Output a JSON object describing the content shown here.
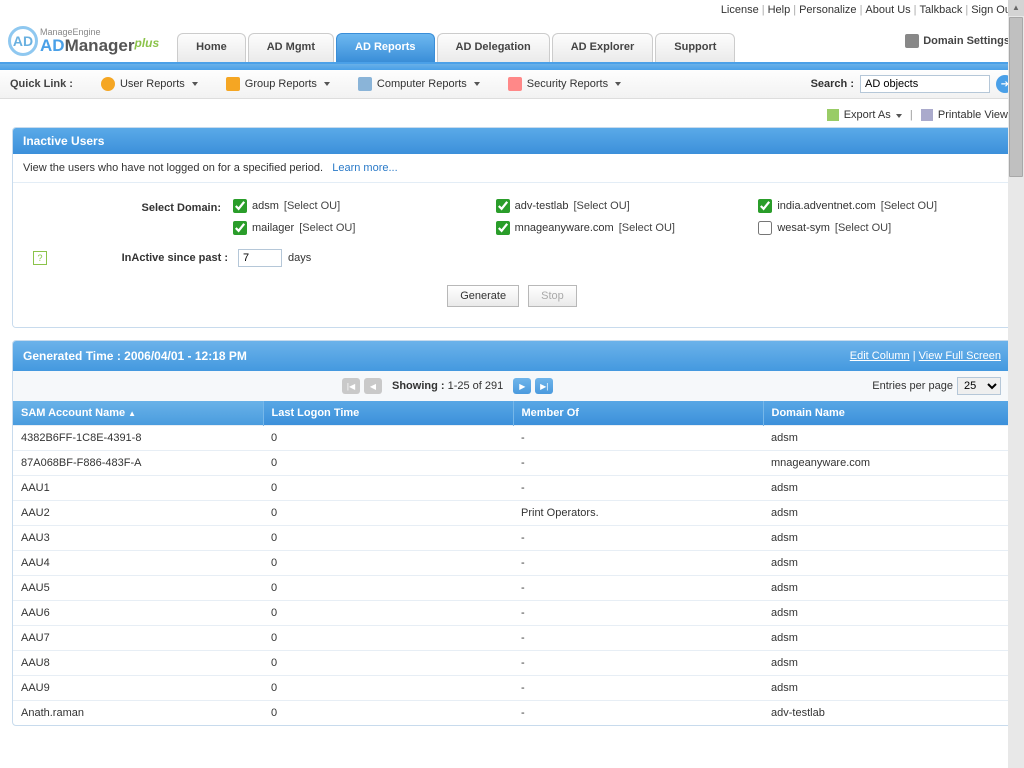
{
  "top_links": [
    "License",
    "Help",
    "Personalize",
    "About Us",
    "Talkback",
    "Sign Out"
  ],
  "logo": {
    "small": "ManageEngine",
    "main_a": "AD",
    "main_m": "Manager",
    "plus": "plus",
    "circle": "AD"
  },
  "tabs": [
    "Home",
    "AD Mgmt",
    "AD Reports",
    "AD Delegation",
    "AD Explorer",
    "Support"
  ],
  "active_tab": 2,
  "domain_settings": "Domain Settings",
  "quick": {
    "label": "Quick Link :",
    "items": [
      "User Reports",
      "Group Reports",
      "Computer Reports",
      "Security Reports"
    ]
  },
  "search": {
    "label": "Search :",
    "value": "AD objects"
  },
  "toolbar": {
    "export": "Export As",
    "printable": "Printable View"
  },
  "panel1": {
    "title": "Inactive Users",
    "desc": "View the users who have not logged on for a specified period.",
    "learn": "Learn more...",
    "select_domain": "Select Domain:",
    "select_ou": "[Select OU]",
    "domains": [
      {
        "name": "adsm",
        "checked": true
      },
      {
        "name": "adv-testlab",
        "checked": true
      },
      {
        "name": "india.adventnet.com",
        "checked": true
      },
      {
        "name": "mailager",
        "checked": true
      },
      {
        "name": "mnageanyware.com",
        "checked": true
      },
      {
        "name": "wesat-sym",
        "checked": false
      }
    ],
    "inactive_label": "InActive since past :",
    "days_value": "7",
    "days_unit": "days",
    "generate": "Generate",
    "stop": "Stop"
  },
  "panel2": {
    "title": "Generated Time : 2006/04/01 - 12:18 PM",
    "edit_col": "Edit Column",
    "full": "View Full Screen",
    "showing_label": "Showing :",
    "showing_range": "1-25 of 291",
    "epp_label": "Entries per page",
    "epp_value": "25",
    "columns": [
      "SAM Account Name",
      "Last Logon Time",
      "Member Of",
      "Domain Name"
    ],
    "sort_col": 0,
    "rows": [
      {
        "sam": "4382B6FF-1C8E-4391-8",
        "last": "0",
        "member": "-",
        "domain": "adsm"
      },
      {
        "sam": "87A068BF-F886-483F-A",
        "last": "0",
        "member": "-",
        "domain": "mnageanyware.com"
      },
      {
        "sam": "AAU1",
        "last": "0",
        "member": "-",
        "domain": "adsm"
      },
      {
        "sam": "AAU2",
        "last": "0",
        "member": "Print Operators.",
        "domain": "adsm"
      },
      {
        "sam": "AAU3",
        "last": "0",
        "member": "-",
        "domain": "adsm"
      },
      {
        "sam": "AAU4",
        "last": "0",
        "member": "-",
        "domain": "adsm"
      },
      {
        "sam": "AAU5",
        "last": "0",
        "member": "-",
        "domain": "adsm"
      },
      {
        "sam": "AAU6",
        "last": "0",
        "member": "-",
        "domain": "adsm"
      },
      {
        "sam": "AAU7",
        "last": "0",
        "member": "-",
        "domain": "adsm"
      },
      {
        "sam": "AAU8",
        "last": "0",
        "member": "-",
        "domain": "adsm"
      },
      {
        "sam": "AAU9",
        "last": "0",
        "member": "-",
        "domain": "adsm"
      },
      {
        "sam": "Anath.raman",
        "last": "0",
        "member": "-",
        "domain": "adv-testlab"
      }
    ]
  }
}
